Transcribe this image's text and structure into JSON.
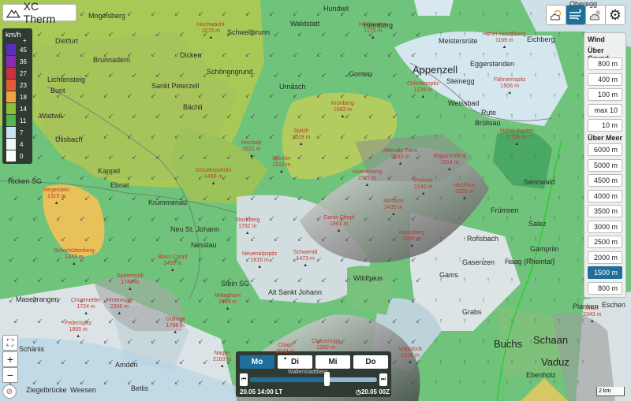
{
  "app": {
    "name": "XC Therm"
  },
  "legend": {
    "unit": "km/h",
    "plus": "+",
    "rows": [
      {
        "value": "45",
        "color": "#5b2fb8"
      },
      {
        "value": "36",
        "color": "#8a2cb0"
      },
      {
        "value": "27",
        "color": "#c8323c"
      },
      {
        "value": "23",
        "color": "#e35d34"
      },
      {
        "value": "18",
        "color": "#f0a43c"
      },
      {
        "value": "14",
        "color": "#8bbf3a"
      },
      {
        "value": "11",
        "color": "#55b64a"
      },
      {
        "value": "7",
        "color": "#c9e4f0"
      },
      {
        "value": "4",
        "color": "#eef5f8"
      },
      {
        "value": "0",
        "color": "#ffffff"
      }
    ]
  },
  "toolbar": {
    "icons": [
      "cloud-sun-icon",
      "wind-icon",
      "thermal-icon",
      "settings-icon"
    ]
  },
  "panel": {
    "title": "Wind",
    "ground_header": "Über Grund",
    "ground_levels": [
      "800 m",
      "400 m",
      "100 m",
      "max 10 m",
      "10 m"
    ],
    "sea_header": "Über Meer",
    "sea_levels": [
      "6000 m",
      "5000 m",
      "4500 m",
      "4000 m",
      "3500 m",
      "3000 m",
      "2500 m",
      "2000 m",
      "1500 m",
      "800 m"
    ],
    "selected": "1500 m"
  },
  "zoom": {
    "in": "+",
    "out": "−"
  },
  "timeline": {
    "days": [
      "Mo",
      "Di",
      "Mi",
      "Do"
    ],
    "selected_day": "Mo",
    "local_time": "20.05 14:00 LT",
    "utc_time": "20.05 00Z",
    "slider_label": "Wallenstadtberg",
    "slider_fraction": 0.6
  },
  "scale": {
    "label": "2 km"
  },
  "towns": [
    {
      "name": "Mogelsberg"
    },
    {
      "name": "Hundwil"
    },
    {
      "name": "Schwellbrunn"
    },
    {
      "name": "Waldstatt"
    },
    {
      "name": "Hemberg"
    },
    {
      "name": "Dietfurt"
    },
    {
      "name": "Brunnadern"
    },
    {
      "name": "Dicken"
    },
    {
      "name": "Schönengrund"
    },
    {
      "name": "Gonten"
    },
    {
      "name": "Appenzell"
    },
    {
      "name": "Steinegg"
    },
    {
      "name": "Weissbad"
    },
    {
      "name": "Rute"
    },
    {
      "name": "Brülisau"
    },
    {
      "name": "Lichtensteig"
    },
    {
      "name": "Bunt"
    },
    {
      "name": "Sankt Peterzell"
    },
    {
      "name": "Bächli"
    },
    {
      "name": "Urnäsch"
    },
    {
      "name": "Wattwil"
    },
    {
      "name": "Ulisbach"
    },
    {
      "name": "Kappel"
    },
    {
      "name": "Ebnat"
    },
    {
      "name": "Krummenau"
    },
    {
      "name": "Ricken SG"
    },
    {
      "name": "Neu St. Johann"
    },
    {
      "name": "Nesslau"
    },
    {
      "name": "Stein SG"
    },
    {
      "name": "Alt Sankt Johann"
    },
    {
      "name": "Wildhaus"
    },
    {
      "name": "Gams"
    },
    {
      "name": "Grabs"
    },
    {
      "name": "Gasenzen"
    },
    {
      "name": "Rofisbach"
    },
    {
      "name": "Frümsen"
    },
    {
      "name": "Salez"
    },
    {
      "name": "Haag (Rheintal)"
    },
    {
      "name": "Gampriin"
    },
    {
      "name": "Buchs"
    },
    {
      "name": "Schaan"
    },
    {
      "name": "Vaduz"
    },
    {
      "name": "Planken"
    },
    {
      "name": "Eschen"
    },
    {
      "name": "Eichberg"
    },
    {
      "name": "Meistersrüte"
    },
    {
      "name": "Eggerstanden"
    },
    {
      "name": "Oberegg"
    },
    {
      "name": "Amden"
    },
    {
      "name": "Weesen"
    },
    {
      "name": "Betlis"
    },
    {
      "name": "Ziegelbrücke"
    },
    {
      "name": "Schänis"
    },
    {
      "name": "Maseltrangen"
    },
    {
      "name": "Ebenholz"
    },
    {
      "name": "Sennwald"
    }
  ],
  "peaks": [
    {
      "name": "Hochwacht",
      "alt": "1075 m"
    },
    {
      "name": "Hochhamm",
      "alt": "1275 m"
    },
    {
      "name": "Hoher Hirschberg",
      "alt": "1169 m"
    },
    {
      "name": "Fähnernspitz",
      "alt": "1506 m"
    },
    {
      "name": "Chlosterspitz",
      "alt": "1239 m"
    },
    {
      "name": "Kronberg",
      "alt": "1663 m"
    },
    {
      "name": "Spitzli",
      "alt": "1519 m"
    },
    {
      "name": "Hochalp",
      "alt": "1521 m"
    },
    {
      "name": "Spicher",
      "alt": "1519 m"
    },
    {
      "name": "Altenalp Turm",
      "alt": "2033 m"
    },
    {
      "name": "Hoher Kasten",
      "alt": "1795 m"
    },
    {
      "name": "Bogartenfirst",
      "alt": "1814 m"
    },
    {
      "name": "Hüenerberg",
      "alt": "2311 m"
    },
    {
      "name": "Freiheit",
      "alt": "2140 m"
    },
    {
      "name": "Hochhus",
      "alt": "1926 m"
    },
    {
      "name": "Gösslerpohöhi",
      "alt": "1430 m"
    },
    {
      "name": "Regelstein",
      "alt": "1315 m"
    },
    {
      "name": "Altmann",
      "alt": "2435 m"
    },
    {
      "name": "Gams Chopf",
      "alt": "1961 m"
    },
    {
      "name": "Kreuzberg",
      "alt": "1998 m"
    },
    {
      "name": "Stockberg",
      "alt": "1782 m"
    },
    {
      "name": "Schwendi",
      "alt": "1473 m"
    },
    {
      "name": "Neuenalpspitz",
      "alt": "1816 m"
    },
    {
      "name": "Schorhüttenberg",
      "alt": "1443 m"
    },
    {
      "name": "Blass Chopf",
      "alt": "1459 m"
    },
    {
      "name": "Speermürli",
      "alt": "1748 m"
    },
    {
      "name": "Chüemettler",
      "alt": "1724 m"
    },
    {
      "name": "Hinterrugg",
      "alt": "2306 m"
    },
    {
      "name": "Chäserrugg",
      "alt": "2262 m"
    },
    {
      "name": "Chapf",
      "alt": "2043 m"
    },
    {
      "name": "Mattstock",
      "alt": "1936 m"
    },
    {
      "name": "Nagler",
      "alt": "2163 m"
    },
    {
      "name": "Gulmen",
      "alt": "1788 m"
    },
    {
      "name": "Mittaghorn",
      "alt": "1549 m"
    },
    {
      "name": "Federispitz",
      "alt": "1865 m"
    },
    {
      "name": "Alvier",
      "alt": "2343 m"
    }
  ]
}
